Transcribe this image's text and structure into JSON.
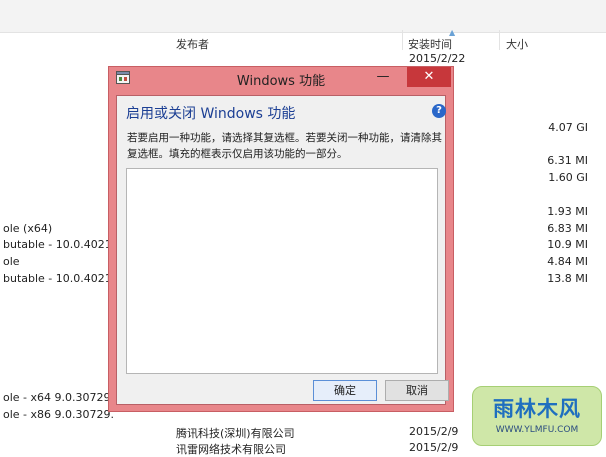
{
  "background_list": {
    "columns": {
      "publisher": "发布者",
      "install_date": "安装时间",
      "size": "大小"
    },
    "rows": [
      {
        "name": "",
        "publisher": "",
        "date": "2015/2/22",
        "size": ""
      },
      {
        "name": "",
        "publisher": "",
        "date": "",
        "size": "4.07 GI"
      },
      {
        "name": "",
        "publisher": "",
        "date": "",
        "size": "6.31 MI"
      },
      {
        "name": "",
        "publisher": "",
        "date": "",
        "size": "1.60 GI"
      },
      {
        "name": "",
        "publisher": "",
        "date": "",
        "size": "1.93 MI"
      },
      {
        "name": "ole (x64)",
        "publisher": "",
        "date": "",
        "size": "6.83 MI"
      },
      {
        "name": "butable - 10.0.4021",
        "publisher": "",
        "date": "",
        "size": "10.9 MI"
      },
      {
        "name": "ole",
        "publisher": "",
        "date": "",
        "size": "4.84 MI"
      },
      {
        "name": "butable - 10.0.4021",
        "publisher": "",
        "date": "",
        "size": "13.8 MI"
      },
      {
        "name": "ole - x64 9.0.30729.",
        "publisher": "",
        "date": "",
        "size": ""
      },
      {
        "name": "ole - x86 9.0.30729.",
        "publisher": "",
        "date": "",
        "size": ""
      },
      {
        "name": "",
        "publisher": "腾讯科技(深圳)有限公司",
        "date": "2015/2/9",
        "size": ""
      },
      {
        "name": "",
        "publisher": "讯雷网络技术有限公司",
        "date": "2015/2/9",
        "size": ""
      }
    ]
  },
  "dialog": {
    "title": "Windows 功能",
    "minimize_glyph": "—",
    "close_glyph": "✕",
    "heading": "启用或关闭 Windows 功能",
    "help_glyph": "?",
    "description": "若要启用一种功能，请选择其复选框。若要关闭一种功能，请清除其复选框。填充的框表示仅启用该功能的一部分。",
    "ok_label": "确定",
    "cancel_label": "取消"
  },
  "watermark": {
    "logo_text": "雨林木风",
    "url_text": "WWW.YLMFU.COM"
  },
  "colors": {
    "titlebar": "#e8868a",
    "close_button": "#c7373b",
    "heading_text": "#1c3f94",
    "help_icon": "#2a67c9"
  }
}
